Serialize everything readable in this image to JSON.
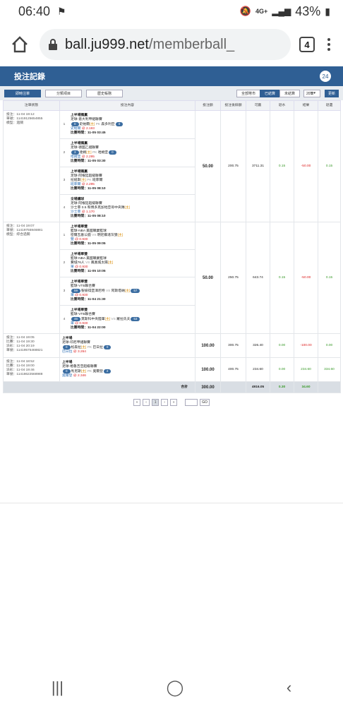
{
  "status": {
    "time": "06:40",
    "network": "4G+",
    "battery": "43%"
  },
  "browser": {
    "url_host": "ball.ju999.net",
    "url_path": "/memberball_",
    "tab_count": "4"
  },
  "header": {
    "title": "投注記錄",
    "support_badge": "24"
  },
  "toolbar": {
    "tabs": [
      "即時注單",
      "分類項目",
      "歷史帳務"
    ],
    "filters": [
      "全部幣市",
      "已結算",
      "未結算"
    ],
    "page_size": "20筆",
    "refresh": "更新"
  },
  "table": {
    "headers": [
      "注單狀態",
      "投注內容",
      "投注額",
      "投注後餘額",
      "可贏",
      "退水",
      "結果",
      "退還"
    ],
    "rows": [
      {
        "info": [
          "投注：11-04 19:12",
          "單號：11419125654855",
          "模型：過關"
        ],
        "legs": [
          {
            "num": "1",
            "type": "上半場獨贏",
            "league": "足球-意大利甲組聯賽",
            "home_badge": "0",
            "home": "史帕爾",
            "home_tag": "[主]",
            "vs": "PK",
            "away": "森多利亞",
            "away_badge": "0",
            "pick": "史帕爾",
            "odds": "@ 2.193",
            "time": "比賽時間：11-05 03:45"
          },
          {
            "num": "2",
            "type": "上半場獨贏",
            "league": "足球-德國乙組聯賽",
            "home_badge": "3",
            "home": "達姆",
            "home_tag": "[主]",
            "vs": "PK",
            "away": "哈姆堡",
            "away_badge": "0",
            "pick": "哈姆堡",
            "odds": "@ 2.295",
            "time": "比賽時間：11-05 03:30"
          },
          {
            "num": "3",
            "type": "上半場獨贏",
            "league": "足球-阿根廷超級聯賽",
            "home_badge": "",
            "home": "拉紐斯",
            "home_tag": "[主]",
            "vs": "PK",
            "away": "班菲爾",
            "away_badge": "",
            "pick": "班菲爾",
            "odds": "@ 2.295",
            "time": "比賽時間：11-05 08:10"
          },
          {
            "num": "4",
            "type": "全場讓球",
            "league": "足球-阿根廷超級聯賽",
            "home_badge": "",
            "home": "沙士菲 0.5 和博多克加地亞哥中央隊",
            "home_tag": "[主]",
            "vs": "",
            "away": "",
            "away_badge": "",
            "pick": "沙士菲",
            "odds": "@ 1.170",
            "time": "比賽時間：11-05 08:10"
          }
        ],
        "stake": "50.00",
        "balance": "200.75",
        "win": "3711.31",
        "rebate": "0.15",
        "result": "-50.00",
        "returned": "0.15"
      },
      {
        "info": [
          "投注：11-04 19:07",
          "單號：11419755946881",
          "模型：綜合過關"
        ],
        "legs": [
          {
            "num": "1",
            "type": "上半場單雙",
            "league": "籃球-NBA 美國職業籃球",
            "home_badge": "",
            "home": "密爾瓦基公鹿",
            "home_tag": "",
            "vs": "VS",
            "away": "明尼蘇達灰狼",
            "away_badge": "",
            "away_tag": "[主]",
            "pick": "雙",
            "odds": "@ 0.930",
            "time": "比賽時間：11-05 09:05"
          },
          {
            "num": "2",
            "type": "上半場單雙",
            "league": "籃球-NBA 美國職業籃球",
            "home_badge": "",
            "home": "費城76人",
            "home_tag": "",
            "vs": "VS",
            "away": "鳳凰城太陽",
            "away_badge": "",
            "away_tag": "[主]",
            "pick": "單",
            "odds": "@ 0.930",
            "time": "比賽時間：11-05 10:05"
          },
          {
            "num": "3",
            "type": "上半場單雙",
            "league": "籃球-VTB聯合賽",
            "home_badge": "59",
            "home": "聖彼得堡澤尼特",
            "home_tag": "",
            "vs": "VS",
            "away": "阿斯塔納",
            "away_badge": "57",
            "away_tag": "[主]",
            "pick": "單",
            "odds": "@ 0.930",
            "time": "比賽時間：11-04 21:30"
          },
          {
            "num": "4",
            "type": "上半場單雙",
            "league": "籃球-VTB聯合賽",
            "home_badge": "46",
            "home": "莫斯科中央陸軍",
            "home_tag": "[主]",
            "vs": "VS",
            "away": "羅拉氏夫",
            "away_badge": "53",
            "away_tag": "",
            "pick": "單",
            "odds": "@ 0.930",
            "time": "比賽時間：11-04 22:00"
          }
        ],
        "stake": "50.00",
        "balance": "250.75",
        "win": "643.74",
        "rebate": "0.15",
        "result": "-50.00",
        "returned": "0.15"
      },
      {
        "info": [
          "投注：11-04 19:05",
          "比賽：11-04 19:30",
          "派彩：11-04 20:19",
          "單號：11419575468821"
        ],
        "legs": [
          {
            "num": "",
            "type": "上半場",
            "league": "足球-印尼甲組聯賽",
            "home_badge": "0",
            "home": "松森拉",
            "home_tag": "[主]",
            "vs": "PK",
            "away": "巴日拉",
            "away_badge": "0",
            "pick": "巴日拉",
            "odds": "@ 3.264",
            "time": ""
          }
        ],
        "stake": "100.00",
        "balance": "300.75",
        "win": "326.40",
        "rebate": "0.00",
        "result": "-100.00",
        "returned": "0.00"
      },
      {
        "info": [
          "投注：11-04 18:52",
          "比賽：11-04 19:00",
          "派彩：11-04 19:46",
          "單號：11418622568988"
        ],
        "legs": [
          {
            "num": "",
            "type": "上半場",
            "league": "足球-格魯吉亞超級聯賽",
            "home_badge": "0",
            "home": "馬尼斯",
            "home_tag": "[主]",
            "vs": "PK",
            "away": "奧爾登",
            "away_badge": "2",
            "pick": "奧爾登",
            "odds": "@ 2.346",
            "time": ""
          }
        ],
        "stake": "100.00",
        "balance": "400.75",
        "win": "234.60",
        "rebate": "0.00",
        "result": "234.60",
        "returned": "334.60"
      }
    ],
    "total": {
      "label": "合計",
      "stake": "300.00",
      "win": "4916.05",
      "rebate": "0.30",
      "result": "34.60"
    }
  },
  "pager": {
    "current": "1",
    "go": "GO"
  }
}
